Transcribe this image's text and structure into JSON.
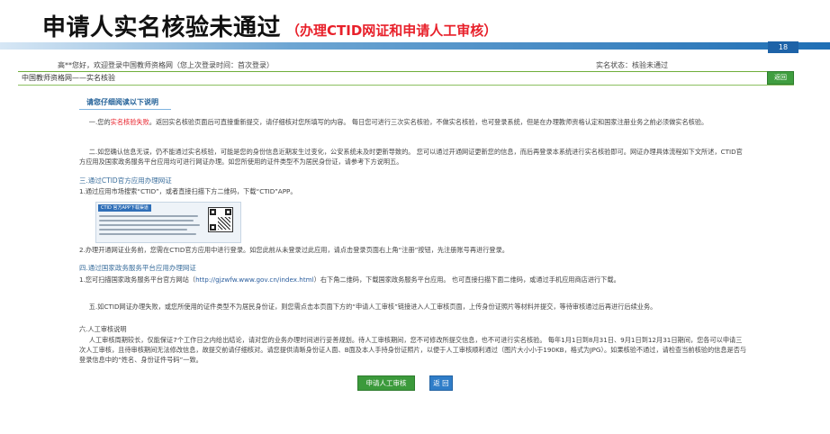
{
  "slide": {
    "title": "申请人实名核验未通过",
    "subtitle": "（办理CTID网证和申请人工审核）",
    "page_number": "18"
  },
  "topbar": {
    "welcome": "高**您好，欢迎登录中国教师资格网（您上次登录时间：首次登录）",
    "status": "实名状态：核验未通过"
  },
  "header": {
    "site_title": "中国教师资格网——实名核验",
    "back_button": "返回"
  },
  "main": {
    "section_heading": "请您仔细阅读以下说明",
    "p1_prefix": "一.您的",
    "p1_highlight": "实名核验失败",
    "p1_rest": "。返回实名核验页面后可直接重新提交，请仔细核对您所填写的内容。 每日您可进行三次实名核验，不做实名核验，也可登录系统，但是在办理教师资格认定和国家注册业务之前必须做实名核验。",
    "p2": "二.如您确认信息无误，仍不能通过实名核验，可能是您的身份信息近期发生过变化，公安系统未及时更新导致的。 您可以通过开通网证更新您的信息，而后再登录本系统进行实名核验即可。网证办理具体流程如下文所述，CTID官方应用及国家政务服务平台应用均可进行网证办理。如您所使用的证件类型不为居民身份证，请参考下方说明五。",
    "ctid_heading": "三.通过CTID官方应用办理网证",
    "ctid_step1": "1.通过应用市场搜索“CTID”，或者直接扫描下方二维码，下载“CTID”APP。",
    "ctid_image_label": "CTID 官方APP下载渠道",
    "ctid_step2": "2.办理开通网证业务前，您需在CTID官方应用中进行登录。如您此前从未登录过此应用，请点击登录页面右上角“注册”按钮，先注册账号再进行登录。",
    "gov_heading": "四.通过国家政务服务平台应用办理网证",
    "gov_step1_prefix": "1.您可扫描国家政务服务平台官方网站（",
    "gov_link": "http://gjzwfw.www.gov.cn/index.html",
    "gov_step1_suffix": "）右下角二维码，下载国家政务服务平台应用。 也可直接扫描下面二维码，或通过手机应用商店进行下载。",
    "p5": "五.如CTID网证办理失败，或您所使用的证件类型不为居民身份证，则您需点击本页面下方的“申请人工审核”链接进入人工审核页面，上传身份证照片等材料并提交，等待审核通过后再进行后续业务。",
    "manual_heading": "六.人工审核说明",
    "manual_body": "人工审核周期较长，仅能保证7个工作日之内给出结论，请对您的业务办理时间进行妥善规划。待人工审核期间，您不可修改所提交信息，也不可进行实名核验。 每年1月1日到8月31日、9月1日到12月31日期间，您各可以申请三次人工审核，且待审核期间无法修改信息，故提交前请仔细核对。请您提供清晰身份证人面、B面及本人手持身份证照片，以便于人工审核顺利通过（图片大小小于190KB，格式为JPG）。如果核验不通过，请检查当前核验的信息是否与登录信息中的“姓名、身份证件号码”一致。"
  },
  "actions": {
    "manual_review_button": "申请人工审核",
    "return_button": "返 回"
  },
  "colors": {
    "title_accent": "#e8202a",
    "banner_blue": "#1f6fb5",
    "button_green": "#3b9a3b",
    "button_blue": "#2f7dc8"
  }
}
